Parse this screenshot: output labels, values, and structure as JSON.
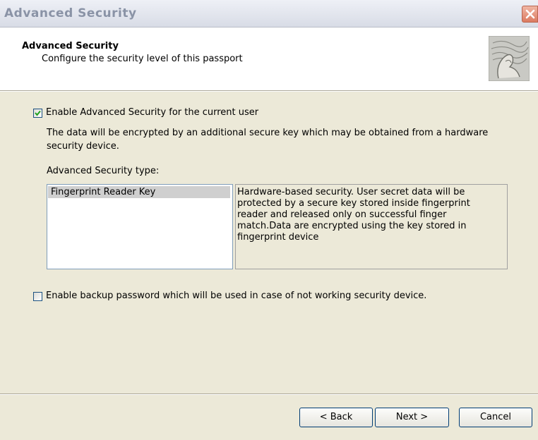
{
  "window": {
    "title": "Advanced Security"
  },
  "header": {
    "title": "Advanced Security",
    "subtitle": "Configure the security level of this passport",
    "icon": "fingerprint-image"
  },
  "main": {
    "enable_checkbox": {
      "label": "Enable Advanced Security for the current user",
      "checked": true
    },
    "description_line1": "The data will be encrypted by an additional secure key which may be obtained from a hardware",
    "description_line2": "security device.",
    "type_label": "Advanced Security type:",
    "type_list": [
      "Fingerprint Reader Key"
    ],
    "type_selected": "Fingerprint Reader Key",
    "type_description": [
      "Hardware-based security. User secret data will be",
      "protected by a secure key stored inside fingerprint",
      "reader and released only on successful finger",
      "match.Data are encrypted using the key stored in",
      "fingerprint device"
    ],
    "backup_checkbox": {
      "label": "Enable backup password which will be used in case of not working security device.",
      "checked": false
    }
  },
  "footer": {
    "back_label": "< Back",
    "next_label": "Next >",
    "cancel_label": "Cancel"
  },
  "colors": {
    "check_mark": "#21a121",
    "close_button": "#dc7a60"
  }
}
